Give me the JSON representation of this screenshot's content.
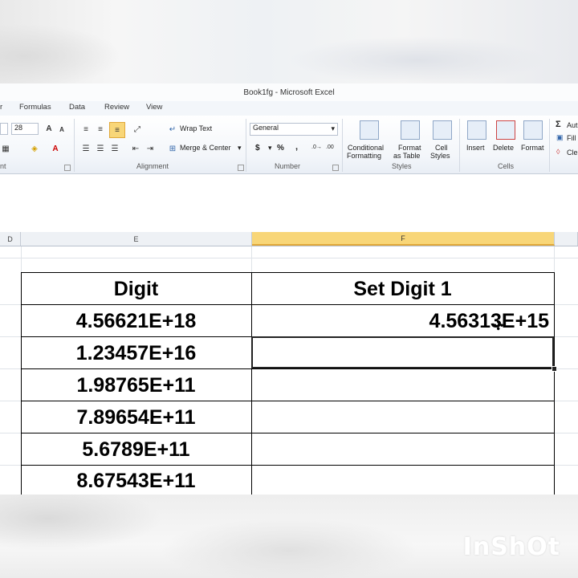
{
  "window": {
    "title": "Book1fg  -  Microsoft Excel"
  },
  "ribbon_tabs": [
    "Formulas",
    "Data",
    "Review",
    "View"
  ],
  "ribbon": {
    "font_size": "28",
    "wrap_text": "Wrap Text",
    "merge_center": "Merge & Center",
    "number_format": "General",
    "currency": "$",
    "percent": "%",
    "comma": ",",
    "conditional_formatting": [
      "Conditional",
      "Formatting"
    ],
    "format_as_table": [
      "Format",
      "as Table"
    ],
    "cell_styles": [
      "Cell",
      "Styles"
    ],
    "insert": "Insert",
    "delete": "Delete",
    "format": "Format",
    "autosum_partial": "Aut",
    "fill_partial": "Fill",
    "clear_partial": "Cle",
    "groups": {
      "font_partial": "nt",
      "alignment": "Alignment",
      "number": "Number",
      "styles": "Styles",
      "cells": "Cells"
    }
  },
  "columns": {
    "d_partial": "D",
    "e": "E",
    "f": "F"
  },
  "table": {
    "headers": [
      "Digit",
      "Set Digit 1"
    ],
    "rows": [
      [
        "4.56621E+18",
        "4.56313E+15"
      ],
      [
        "1.23457E+16",
        ""
      ],
      [
        "1.98765E+11",
        ""
      ],
      [
        "7.89654E+11",
        ""
      ],
      [
        "5.6789E+11",
        ""
      ],
      [
        "8.67543E+11",
        ""
      ]
    ]
  },
  "watermark": "InShOt",
  "icons": [
    "increase-font-icon",
    "decrease-font-icon",
    "align-top-icon",
    "align-middle-icon",
    "align-bottom-icon",
    "orientation-icon",
    "borders-icon",
    "fill-color-icon",
    "font-color-icon",
    "cell-cursor-icon"
  ]
}
